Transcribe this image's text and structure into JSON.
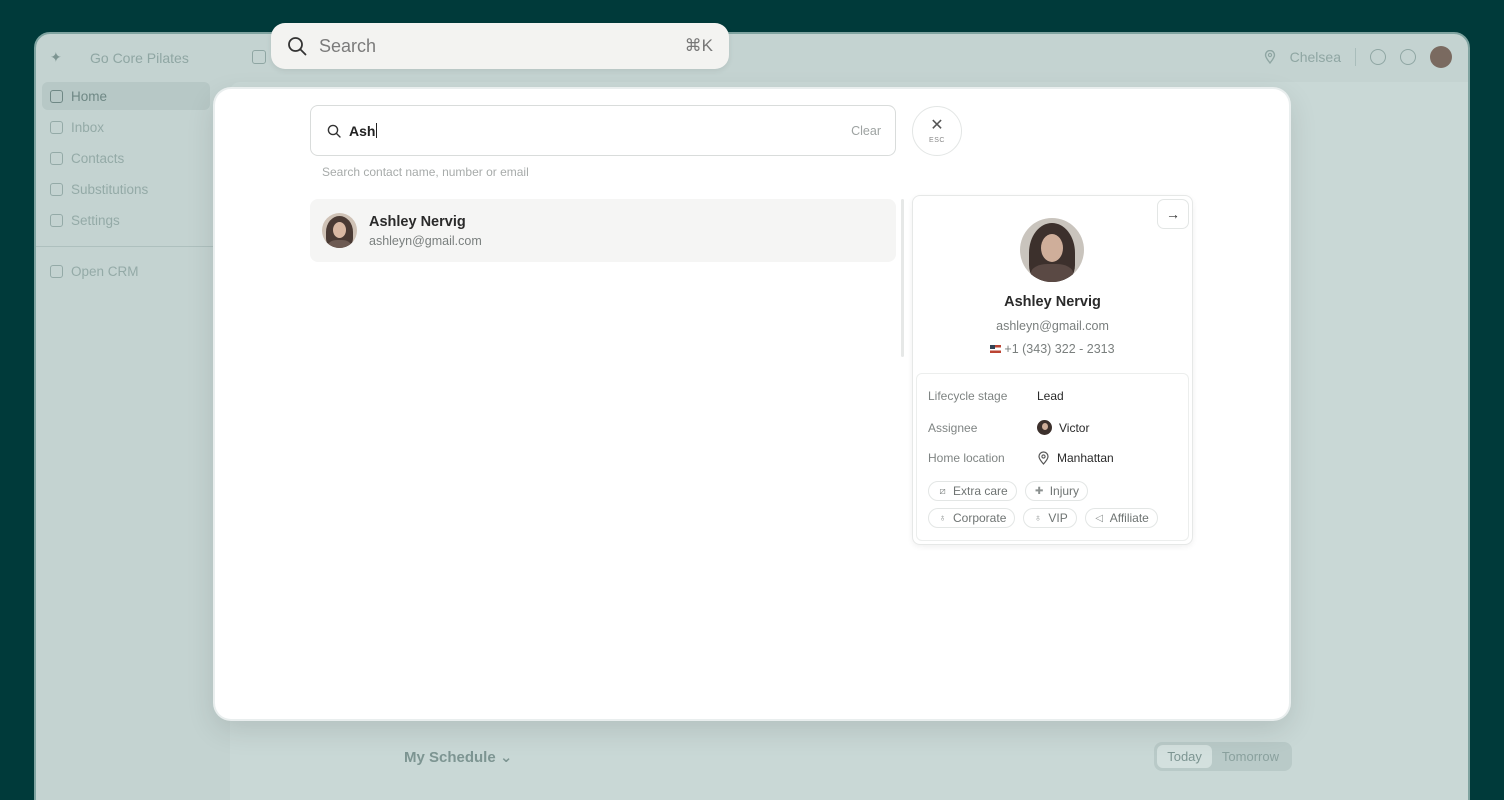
{
  "app": {
    "brand": "Go Core Pilates",
    "location": "Chelsea",
    "sidebar": {
      "items": [
        {
          "label": "Home",
          "icon": "home-icon"
        },
        {
          "label": "Inbox",
          "icon": "inbox-icon"
        },
        {
          "label": "Contacts",
          "icon": "contacts-icon"
        },
        {
          "label": "Substitutions",
          "icon": "users-icon"
        },
        {
          "label": "Settings",
          "icon": "gear-icon"
        }
      ],
      "open_crm": "Open CRM"
    },
    "schedule_label": "My Schedule",
    "day_tabs": [
      "Today",
      "Tomorrow"
    ]
  },
  "top_search": {
    "placeholder": "Search",
    "shortcut": "⌘K"
  },
  "modal": {
    "search_value": "Ash",
    "clear_label": "Clear",
    "close_hint": "ESC",
    "hint": "Search contact name, number or email",
    "results": [
      {
        "name": "Ashley Nervig",
        "email": "ashleyn@gmail.com"
      }
    ],
    "contact": {
      "name": "Ashley Nervig",
      "email": "ashleyn@gmail.com",
      "phone": "+1 (343) 322 - 2313",
      "details": {
        "lifecycle_label": "Lifecycle stage",
        "lifecycle_value": "Lead",
        "assignee_label": "Assignee",
        "assignee_value": "Victor",
        "location_label": "Home location",
        "location_value": "Manhattan"
      },
      "tags": [
        {
          "label": "Extra care",
          "icon": "bandage-icon"
        },
        {
          "label": "Injury",
          "icon": "cross-icon"
        },
        {
          "label": "Corporate",
          "icon": "award-icon"
        },
        {
          "label": "VIP",
          "icon": "award-icon"
        },
        {
          "label": "Affiliate",
          "icon": "megaphone-icon"
        }
      ]
    }
  },
  "colors": {
    "backdrop": "#003a3a",
    "modal": "#ffffff",
    "result_highlight": "#f5f5f4"
  }
}
